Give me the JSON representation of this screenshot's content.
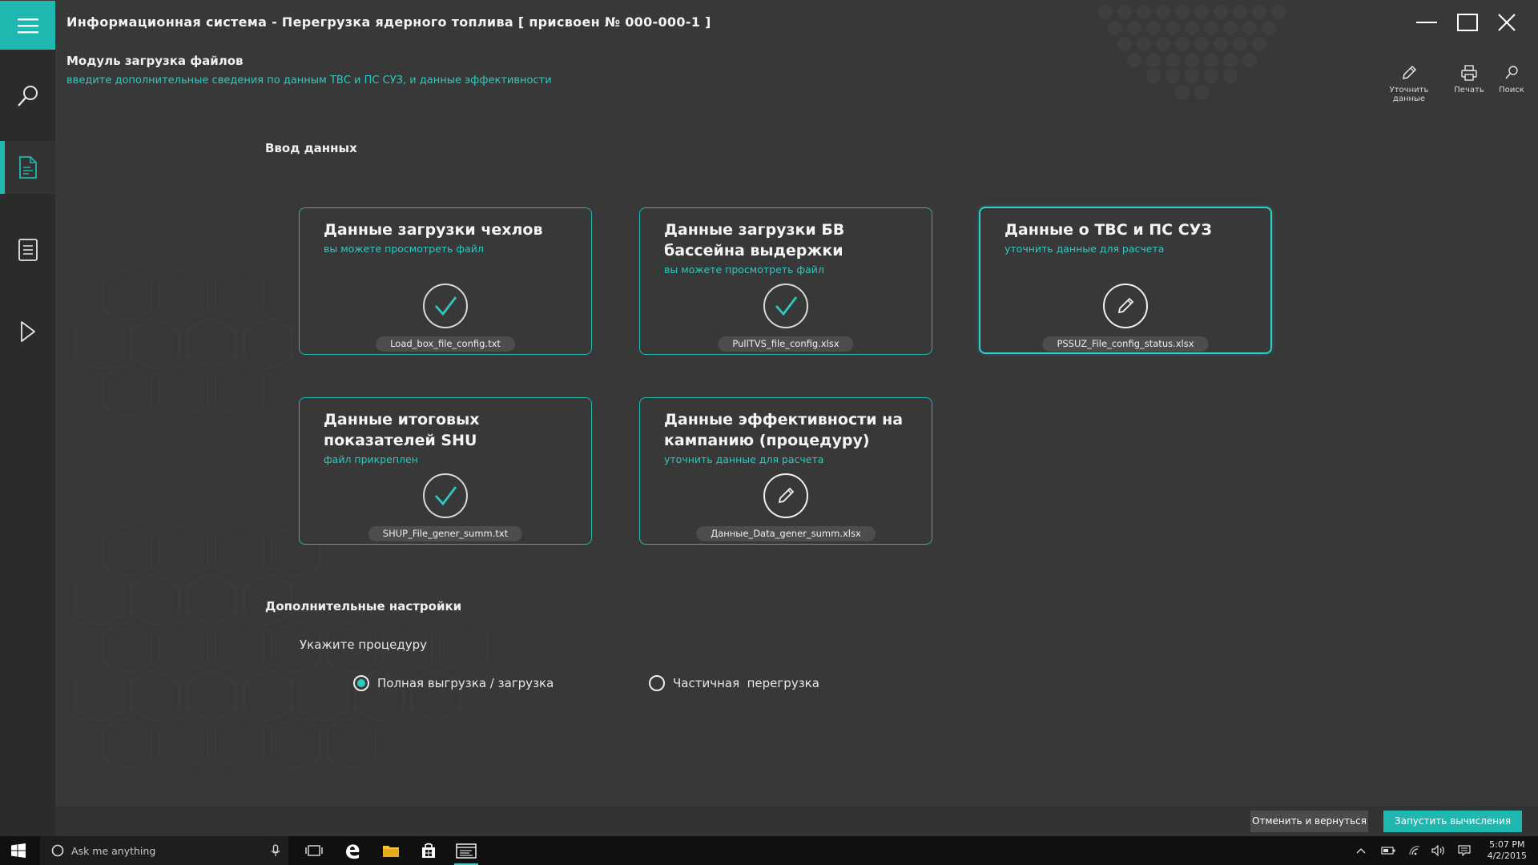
{
  "window": {
    "title": "Информационная система - Перегрузка ядерного топлива [ присвоен № 000-000-1 ]",
    "minimize_icon": "minimize-icon",
    "maximize_icon": "maximize-icon",
    "close_icon": "close-icon"
  },
  "sidebar": {
    "items": [
      {
        "name": "menu",
        "icon": "hamburger-icon"
      },
      {
        "name": "search",
        "icon": "search-icon"
      },
      {
        "name": "document",
        "icon": "document-icon",
        "active": true
      },
      {
        "name": "list",
        "icon": "list-icon"
      },
      {
        "name": "run",
        "icon": "play-icon"
      }
    ]
  },
  "header": {
    "module_title": "Модуль загрузка файлов",
    "module_subtitle": "введите дополнительные сведения по данным ТВС и ПС СУЗ, и данные эффективности"
  },
  "toolbar": {
    "edit_label": "Уточнить данные",
    "print_label": "Печать",
    "search_label": "Поиск"
  },
  "input_section": {
    "title": "Ввод данных",
    "cards": [
      {
        "title": "Данные загрузки чехлов",
        "subtitle": "вы можете просмотреть файл",
        "status": "check-icon",
        "file": "Load_box_file_config.txt"
      },
      {
        "title": "Данные загрузки БВ бассейна выдержки",
        "subtitle": "вы можете просмотреть файл",
        "status": "check-icon",
        "file": "PullTVS_file_config.xlsx"
      },
      {
        "title": "Данные о ТВС и ПС СУЗ",
        "subtitle": "уточнить данные для расчета",
        "status": "pencil-icon",
        "file": "PSSUZ_File_config_status.xlsx"
      },
      {
        "title": "Данные итоговых показателей SHU",
        "subtitle": "файл прикреплен",
        "status": "check-icon",
        "file": "SHUP_File_gener_summ.txt"
      },
      {
        "title": "Данные эффективности на кампанию (процедуру)",
        "subtitle": "уточнить данные для расчета",
        "status": "pencil-icon",
        "file": "Данные_Data_gener_summ.xlsx"
      }
    ]
  },
  "settings_section": {
    "title": "Дополнительные настройки",
    "procedure_label": "Укажите процедуру",
    "options": [
      {
        "label": "Полная выгрузка / загрузка",
        "selected": true
      },
      {
        "label": "Частичная  перегрузка",
        "selected": false
      }
    ]
  },
  "actions": {
    "cancel_label": "Отменить и вернуться",
    "run_label": "Запустить вычисления"
  },
  "taskbar": {
    "search_placeholder": "Ask me anything",
    "time": "5:07 PM",
    "date": "4/2/2015"
  },
  "colors": {
    "accent": "#1fb8b1",
    "accent_text": "#2ec9c0",
    "background": "#383838"
  }
}
